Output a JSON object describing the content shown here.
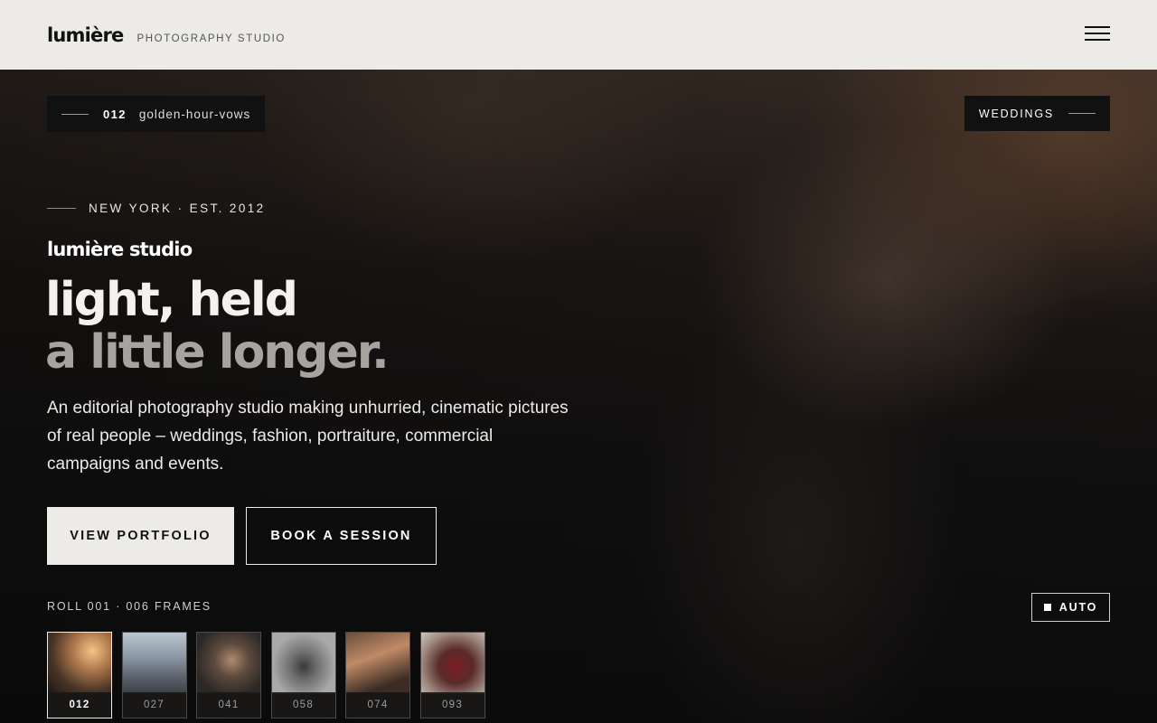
{
  "header": {
    "logo": "lumière",
    "tagline": "PHOTOGRAPHY STUDIO"
  },
  "hero": {
    "frame_tag": {
      "number": "012",
      "slug": "golden-hour-vows"
    },
    "category": "WEDDINGS",
    "eyebrow": "NEW YORK · EST. 2012",
    "studio_name": "lumière studio",
    "headline_line1": "light, held",
    "headline_line2": "a little longer.",
    "lede": "An editorial photography studio making unhurried, cinematic pictures of real people – weddings, fashion, portraiture, commercial campaigns and events.",
    "primary_button": "VIEW PORTFOLIO",
    "secondary_button": "BOOK A SESSION",
    "roll_label": "ROLL 001 · 006 FRAMES",
    "auto_label": "AUTO",
    "thumbnails": [
      {
        "label": "012",
        "active": true
      },
      {
        "label": "027",
        "active": false
      },
      {
        "label": "041",
        "active": false
      },
      {
        "label": "058",
        "active": false
      },
      {
        "label": "074",
        "active": false
      },
      {
        "label": "093",
        "active": false
      }
    ]
  },
  "colors": {
    "header_bg": "#ecebe8",
    "hero_bg": "#0d0c0b",
    "muted_text": "#a6a49f"
  }
}
